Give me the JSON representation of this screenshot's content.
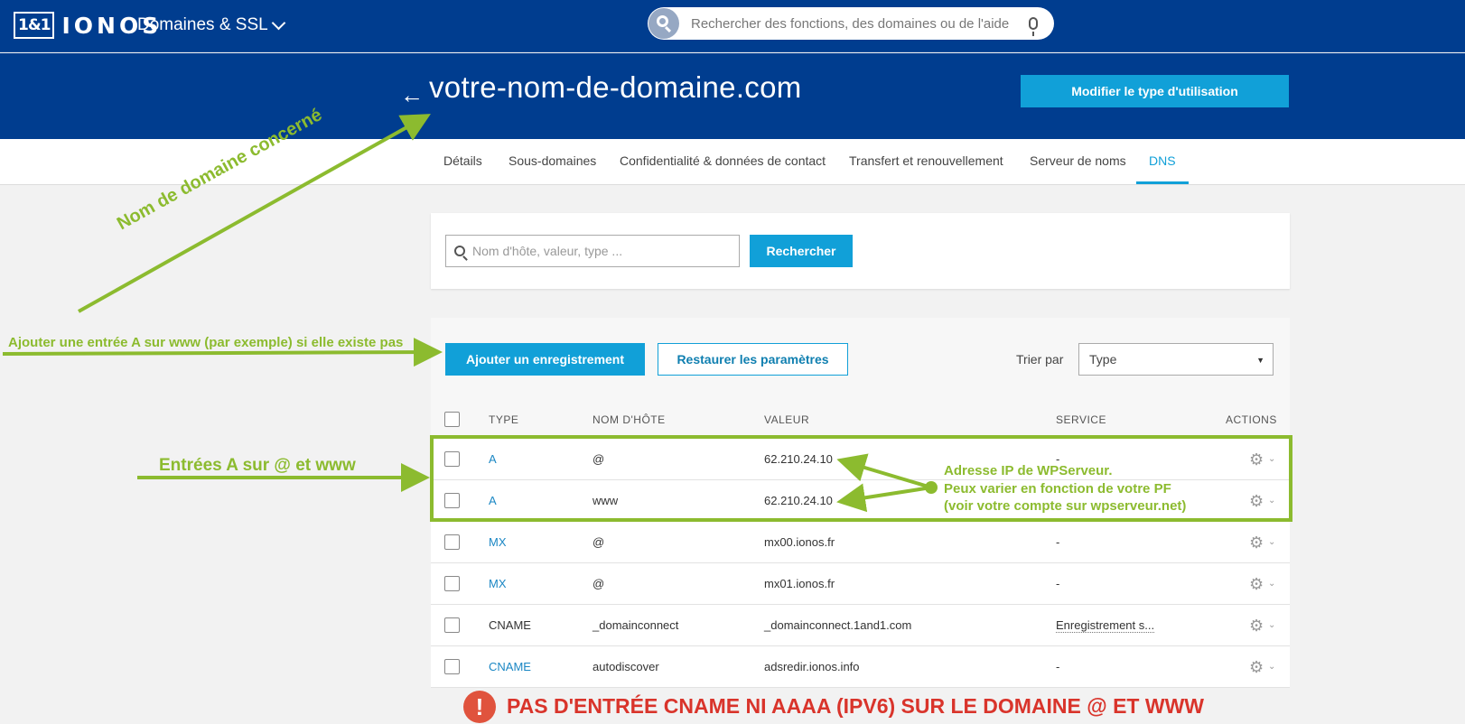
{
  "header": {
    "logo_box": "1&1",
    "logo_text": "IONOS",
    "product": "Domaines & SSL",
    "search_placeholder": "Rechercher des fonctions, des domaines ou de l'aide"
  },
  "domain": {
    "back": "←",
    "title": "votre-nom-de-domaine.com",
    "modify_button": "Modifier le type d'utilisation"
  },
  "tabs": [
    "Détails",
    "Sous-domaines",
    "Confidentialité & données de contact",
    "Transfert et renouvellement",
    "Serveur de noms",
    "DNS"
  ],
  "active_tab": "DNS",
  "search": {
    "placeholder": "Nom d'hôte, valeur, type ...",
    "button": "Rechercher"
  },
  "actions": {
    "add": "Ajouter un enregistrement",
    "restore": "Restaurer les paramètres",
    "sort_label": "Trier par",
    "sort_value": "Type"
  },
  "table": {
    "columns": [
      "TYPE",
      "NOM D'HÔTE",
      "VALEUR",
      "SERVICE",
      "ACTIONS"
    ],
    "rows": [
      {
        "type": "A",
        "host": "@",
        "value": "62.210.24.10",
        "service": "-"
      },
      {
        "type": "A",
        "host": "www",
        "value": "62.210.24.10",
        "service": ""
      },
      {
        "type": "MX",
        "host": "@",
        "value": "mx00.ionos.fr",
        "service": "-"
      },
      {
        "type": "MX",
        "host": "@",
        "value": "mx01.ionos.fr",
        "service": "-"
      },
      {
        "type": "CNAME",
        "host": "_domainconnect",
        "value": "_domainconnect.1and1.com",
        "service": "Enregistrement s..."
      },
      {
        "type": "CNAME",
        "host": "autodiscover",
        "value": "adsredir.ionos.info",
        "service": "-"
      }
    ]
  },
  "annotations": {
    "domain_note": "Nom de domaine concerné",
    "add_note": "Ajouter une entrée A sur www (par exemple) si elle existe pas",
    "entries_note": "Entrées A sur @ et www",
    "ip_note_1": "Adresse IP de WPServeur.",
    "ip_note_2": "Peux varier en fonction de votre PF",
    "ip_note_3": "(voir votre compte sur wpserveur.net)",
    "warning_icon": "!",
    "warning": "PAS D'ENTRÉE CNAME NI AAAA (IPV6) SUR LE DOMAINE @ ET WWW"
  },
  "colors": {
    "brand_dark": "#003d8f",
    "accent": "#11a0d8",
    "annotation_green": "#8cbb2f",
    "warning_red": "#d9342b"
  }
}
